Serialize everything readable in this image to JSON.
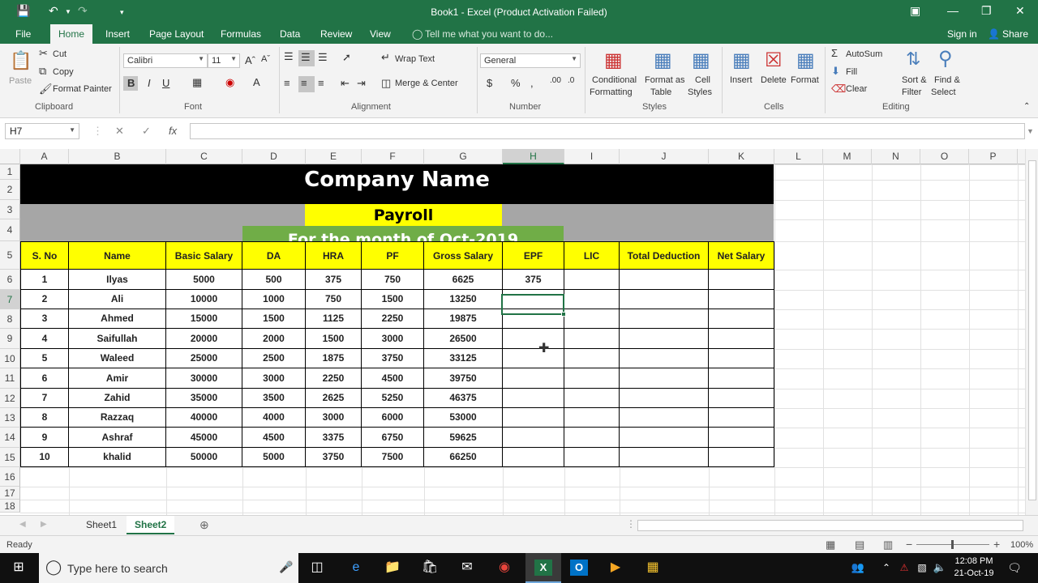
{
  "title": "Book1 - Excel (Product Activation Failed)",
  "menu": {
    "file": "File",
    "home": "Home",
    "insert": "Insert",
    "page_layout": "Page Layout",
    "formulas": "Formulas",
    "data": "Data",
    "review": "Review",
    "view": "View",
    "tell_me": "Tell me what you want to do...",
    "sign_in": "Sign in",
    "share": "Share"
  },
  "ribbon": {
    "clipboard": {
      "paste": "Paste",
      "cut": "Cut",
      "copy": "Copy",
      "format_painter": "Format Painter",
      "label": "Clipboard"
    },
    "font": {
      "name": "Calibri",
      "size": "11",
      "label": "Font"
    },
    "alignment": {
      "wrap_text": "Wrap Text",
      "merge_center": "Merge & Center",
      "label": "Alignment"
    },
    "number": {
      "format": "General",
      "label": "Number"
    },
    "styles": {
      "conditional": "Conditional",
      "formatting": "Formatting",
      "format_as": "Format as",
      "table": "Table",
      "cell": "Cell",
      "styles_txt": "Styles",
      "label": "Styles"
    },
    "cells": {
      "insert": "Insert",
      "delete": "Delete",
      "format": "Format",
      "label": "Cells"
    },
    "editing": {
      "autosum": "AutoSum",
      "fill": "Fill",
      "clear": "Clear",
      "sort": "Sort &",
      "filter": "Filter",
      "find": "Find &",
      "select": "Select",
      "label": "Editing"
    }
  },
  "namebox": "H7",
  "columns": [
    "A",
    "B",
    "C",
    "D",
    "E",
    "F",
    "G",
    "H",
    "I",
    "J",
    "K",
    "L",
    "M",
    "N",
    "O",
    "P"
  ],
  "rows": [
    "1",
    "2",
    "3",
    "4",
    "5",
    "6",
    "7",
    "8",
    "9",
    "10",
    "11",
    "12",
    "13",
    "14",
    "15",
    "16",
    "17",
    "18"
  ],
  "sheet": {
    "company": "Company Name",
    "payroll": "Payroll",
    "month": "For the month of Oct-2019",
    "headers": [
      "S. No",
      "Name",
      "Basic Salary",
      "DA",
      "HRA",
      "PF",
      "Gross Salary",
      "EPF",
      "LIC",
      "Total Deduction",
      "Net Salary"
    ],
    "data": [
      [
        "1",
        "Ilyas",
        "5000",
        "500",
        "375",
        "750",
        "6625",
        "375",
        "",
        "",
        ""
      ],
      [
        "2",
        "Ali",
        "10000",
        "1000",
        "750",
        "1500",
        "13250",
        "",
        "",
        "",
        ""
      ],
      [
        "3",
        "Ahmed",
        "15000",
        "1500",
        "1125",
        "2250",
        "19875",
        "",
        "",
        "",
        ""
      ],
      [
        "4",
        "Saifullah",
        "20000",
        "2000",
        "1500",
        "3000",
        "26500",
        "",
        "",
        "",
        ""
      ],
      [
        "5",
        "Waleed",
        "25000",
        "2500",
        "1875",
        "3750",
        "33125",
        "",
        "",
        "",
        ""
      ],
      [
        "6",
        "Amir",
        "30000",
        "3000",
        "2250",
        "4500",
        "39750",
        "",
        "",
        "",
        ""
      ],
      [
        "7",
        "Zahid",
        "35000",
        "3500",
        "2625",
        "5250",
        "46375",
        "",
        "",
        "",
        ""
      ],
      [
        "8",
        "Razzaq",
        "40000",
        "4000",
        "3000",
        "6000",
        "53000",
        "",
        "",
        "",
        ""
      ],
      [
        "9",
        "Ashraf",
        "45000",
        "4500",
        "3375",
        "6750",
        "59625",
        "",
        "",
        "",
        ""
      ],
      [
        "10",
        "khalid",
        "50000",
        "5000",
        "3750",
        "7500",
        "66250",
        "",
        "",
        "",
        ""
      ]
    ]
  },
  "sheet_tabs": [
    "Sheet1",
    "Sheet2"
  ],
  "active_sheet": "Sheet2",
  "status": {
    "ready": "Ready",
    "zoom": "100%"
  },
  "taskbar": {
    "search": "Type here to search",
    "time": "12:08 PM",
    "date": "21-Oct-19"
  },
  "colors": {
    "excel_green": "#217346",
    "title_black": "#000000",
    "grey_band": "#a6a6a6",
    "yellow": "#ffff00",
    "month_green": "#70ad47"
  }
}
